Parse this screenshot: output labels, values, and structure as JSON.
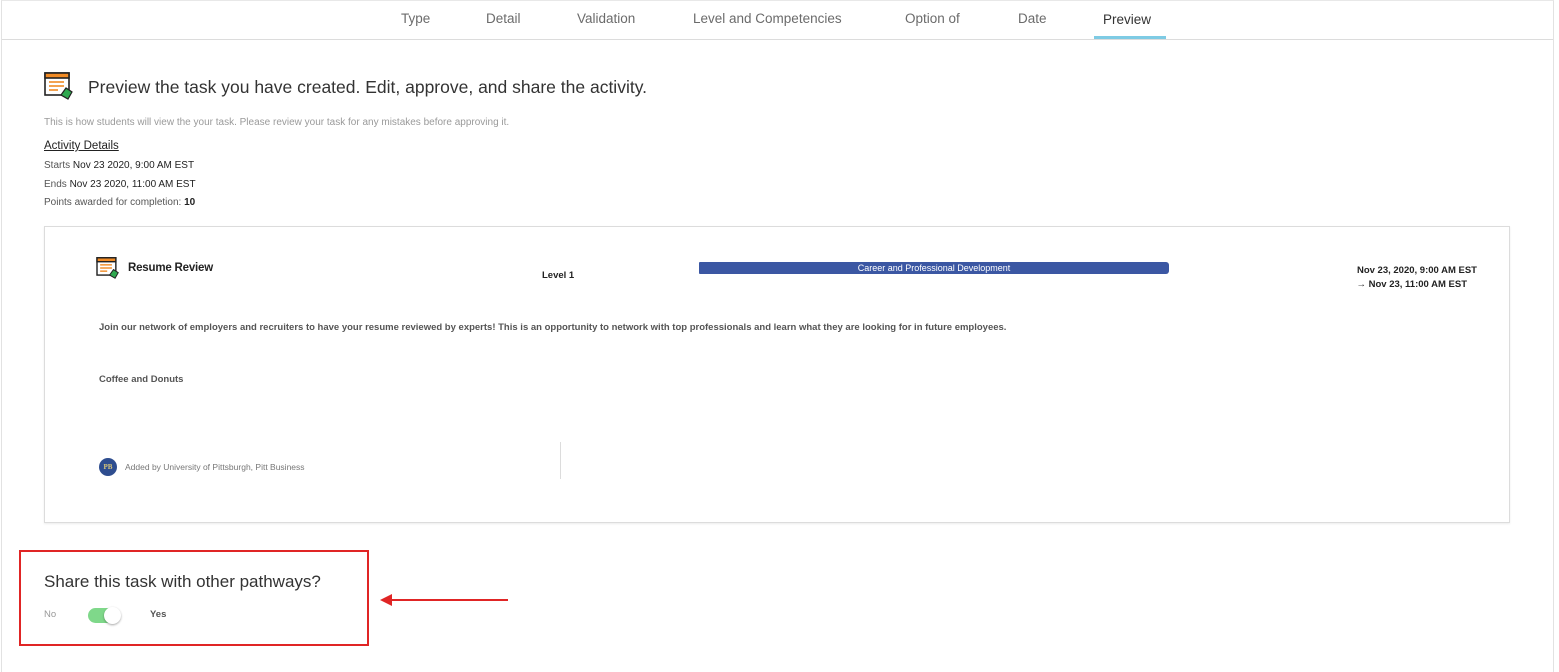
{
  "tabs": [
    {
      "label": "Type"
    },
    {
      "label": "Detail"
    },
    {
      "label": "Validation"
    },
    {
      "label": "Level and Competencies"
    },
    {
      "label": "Option of"
    },
    {
      "label": "Date"
    },
    {
      "label": "Preview",
      "active": true
    }
  ],
  "header": {
    "icon": "task-list-icon",
    "title": "Preview the task you have created. Edit, approve, and share the activity.",
    "subtitle": "This is how students will view the your task. Please review your task for any mistakes before approving it."
  },
  "activity_details": {
    "link_label": "Activity Details",
    "starts_label": "Starts",
    "starts_value": "Nov 23 2020, 9:00 AM EST",
    "ends_label": "Ends",
    "ends_value": "Nov 23 2020, 11:00 AM EST",
    "points_label": "Points awarded for completion:",
    "points_value": "10"
  },
  "card": {
    "icon": "task-list-icon",
    "title": "Resume Review",
    "level": "Level 1",
    "competency": "Career and Professional Development",
    "competency_color": "#3b57a3",
    "date_start": "Nov 23, 2020, 9:00 AM EST",
    "date_end": "Nov 23, 11:00 AM EST",
    "date_arrow_icon": "arrow-right-icon",
    "description": "Join our network of employers and recruiters to have your resume reviewed by experts! This is an opportunity to network with top professionals and learn what they are looking for in future employees.",
    "extra": "Coffee and Donuts",
    "avatar_text": "PB",
    "added_by": "Added by University of Pittsburgh, Pitt Business"
  },
  "share": {
    "title": "Share this task with other pathways?",
    "no_label": "No",
    "yes_label": "Yes",
    "toggle_on": true,
    "toggle_color": "#7fd88a",
    "highlight_color": "#e02525"
  }
}
